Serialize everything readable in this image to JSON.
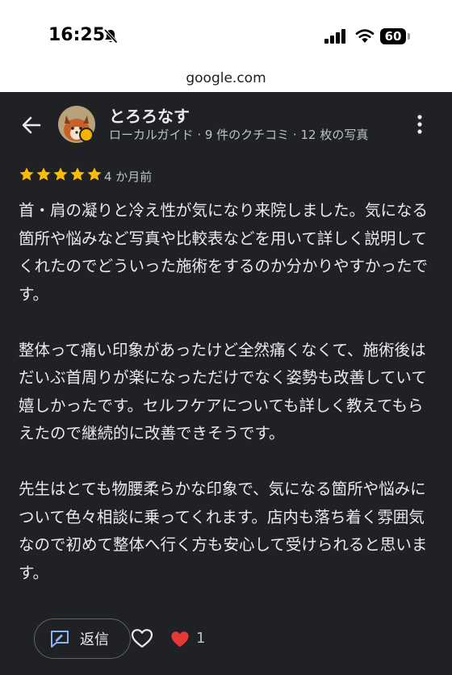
{
  "status_bar": {
    "time": "16:25",
    "battery": "60"
  },
  "browser": {
    "url": "google.com"
  },
  "review": {
    "reviewer_name": "とろろなす",
    "reviewer_meta": "ローカルガイド · 9 件のクチコミ · 12 枚の写真",
    "rating": 5,
    "time_ago": "4 か月前",
    "paragraphs": [
      "首・肩の凝りと冷え性が気になり来院しました。気になる箇所や悩みなど写真や比較表などを用いて詳しく説明してくれたのでどういった施術をするのか分かりやすかったです。",
      "整体って痛い印象があったけど全然痛くなくて、施術後はだいぶ首周りが楽になっただけでなく姿勢も改善していて嬉しかったです。セルフケアについても詳しく教えてもらえたので継続的に改善できそうです。",
      "先生はとても物腰柔らかな印象で、気になる箇所や悩みについて色々相談に乗ってくれます。店内も落ち着く雰囲気なので初めて整体へ行く方も安心して受けられると思います。"
    ]
  },
  "actions": {
    "reply_label": "返信",
    "like_count": "1"
  },
  "colors": {
    "panel_bg": "#202124",
    "star": "#fbbc04",
    "heart": "#e53935",
    "text": "#e8eaed",
    "secondary_text": "#bdc1c6"
  },
  "icons": [
    "bell-slash-icon",
    "signal-icon",
    "wifi-icon",
    "battery-icon",
    "back-arrow-icon",
    "more-vert-icon",
    "star-icon",
    "reply-icon",
    "heart-outline-icon",
    "heart-filled-icon"
  ]
}
